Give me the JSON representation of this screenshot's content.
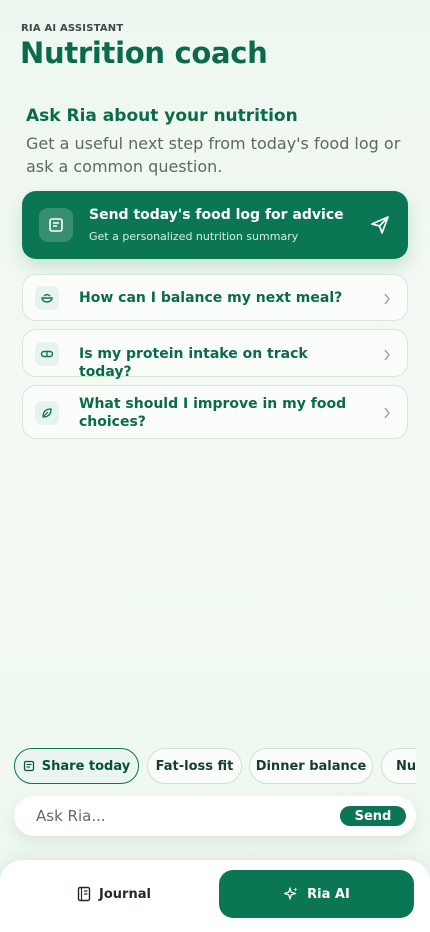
{
  "header": {
    "eyebrow": "RIA AI ASSISTANT",
    "title": "Nutrition coach"
  },
  "intro": {
    "title": "Ask Ria about your nutrition",
    "description": "Get a useful next step from today's food log or ask a common question."
  },
  "hero_action": {
    "title": "Send today's food log for advice",
    "subtitle": "Get a personalized nutrition summary",
    "icon": "document-icon",
    "action_icon": "send-icon"
  },
  "questions": [
    {
      "label": "How can I balance my next meal?",
      "icon": "bowl-icon"
    },
    {
      "label": "Is my protein intake on track today?",
      "icon": "capsule-icon"
    },
    {
      "label": "What should I improve in my food choices?",
      "icon": "leaf-icon"
    }
  ],
  "chips": [
    {
      "label": "Share today",
      "icon": "document-icon",
      "active": true
    },
    {
      "label": "Fat-loss fit",
      "active": false
    },
    {
      "label": "Dinner balance",
      "active": false
    },
    {
      "label": "Nut",
      "active": false
    }
  ],
  "ask": {
    "placeholder": "Ask Ria...",
    "send_label": "Send"
  },
  "nav": {
    "journal_label": "Journal",
    "ria_label": "Ria AI",
    "active": "Ria AI"
  },
  "colors": {
    "brand": "#0b7654",
    "heading": "#0b6a4c",
    "background": "#eef7ef"
  }
}
